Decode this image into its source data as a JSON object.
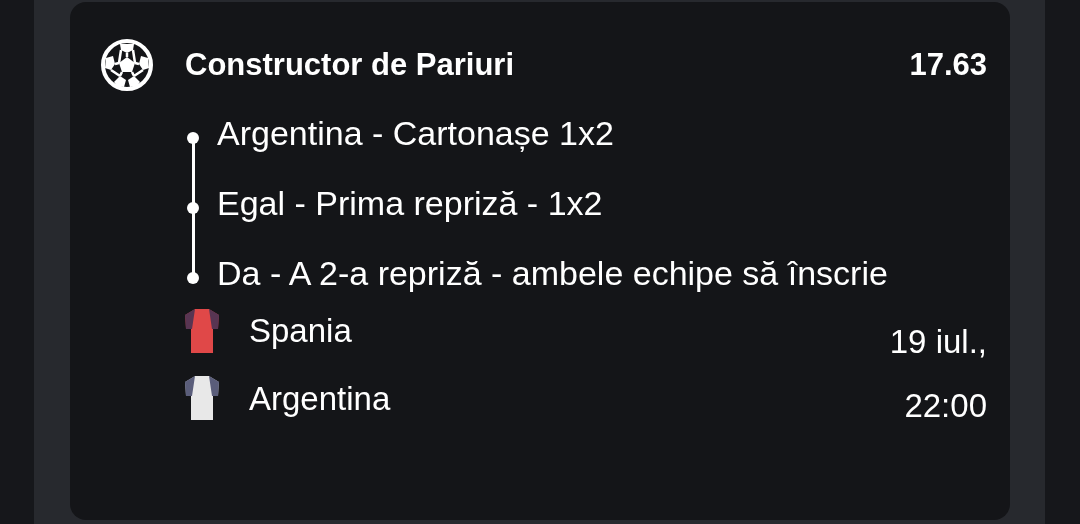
{
  "card": {
    "title": "Constructor de Pariuri",
    "odds": "17.63",
    "selections": [
      {
        "label": "Argentina - Cartonașe 1x2"
      },
      {
        "label": "Egal - Prima repriză - 1x2"
      },
      {
        "label": "Da - A 2-a repriză - ambele echipe să înscrie"
      }
    ],
    "teams": [
      {
        "name": "Spania",
        "color": "#e04848"
      },
      {
        "name": "Argentina",
        "color": "#e8e8e8"
      }
    ],
    "date": "19 iul.,",
    "time": "22:00"
  }
}
